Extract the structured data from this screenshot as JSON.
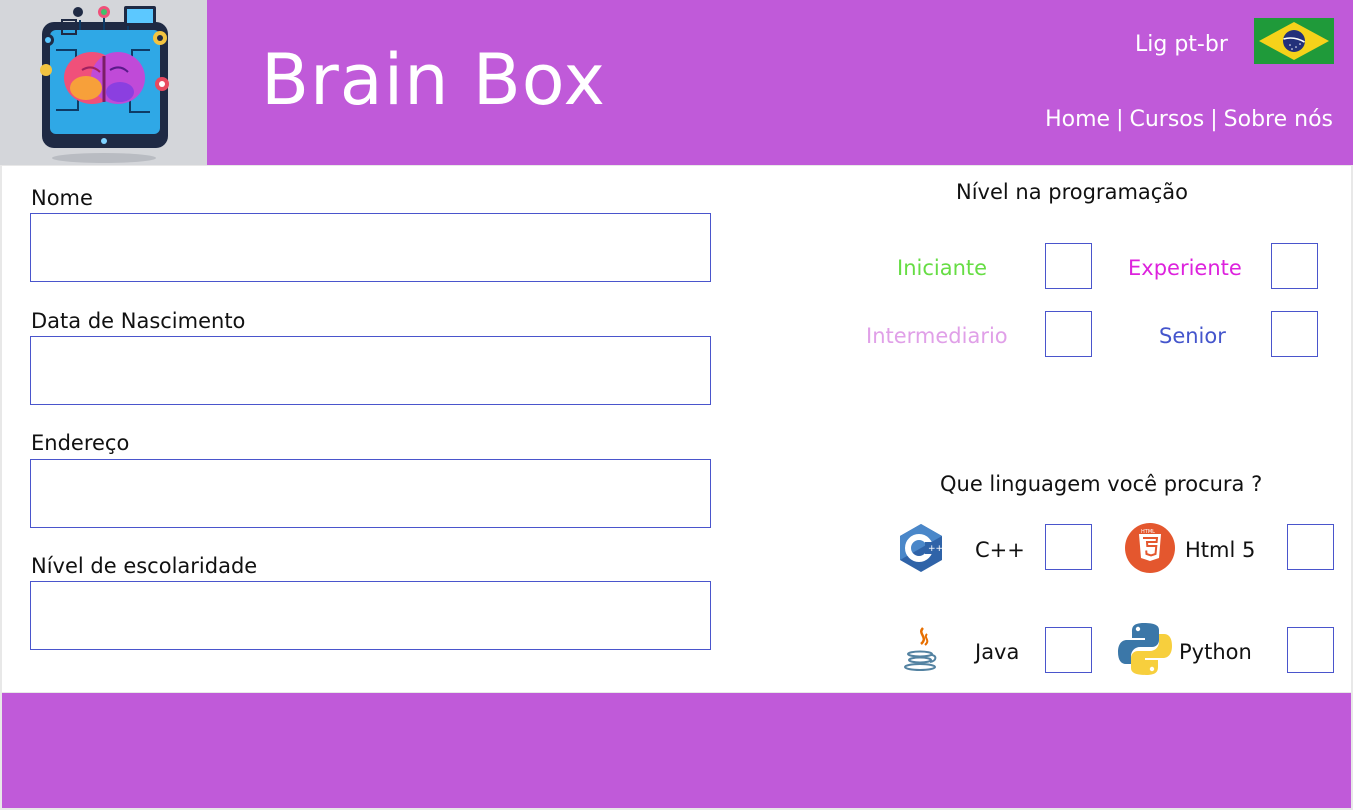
{
  "header": {
    "brand": "Brain Box",
    "language_label": "Lig pt-br",
    "nav": {
      "home": "Home",
      "separator": "|",
      "courses": "Cursos",
      "about": "Sobre nós"
    }
  },
  "form": {
    "name_label": "Nome",
    "birth_label": "Data de Nascimento",
    "address_label": "Endereço",
    "education_label": "Nível de escolaridade"
  },
  "level_section": {
    "title": "Nível na programação",
    "options": {
      "beginner": "Iniciante",
      "experienced": "Experiente",
      "intermediate": "Intermediario",
      "senior": "Senior"
    },
    "colors": {
      "beginner": "#66dd44",
      "experienced": "#dd22dd",
      "intermediate": "#e0a0e8",
      "senior": "#4455cc"
    }
  },
  "languages_section": {
    "title": "Que linguagem você procura ?",
    "options": {
      "cpp": "C++",
      "html": "Html 5",
      "java": "Java",
      "python": "Python"
    },
    "icons": {
      "cpp": "cpp-logo-icon",
      "html": "html5-logo-icon",
      "java": "java-logo-icon",
      "python": "python-logo-icon"
    }
  },
  "theme": {
    "header_bg": "#c05ad9",
    "input_border": "#4a55cc"
  }
}
